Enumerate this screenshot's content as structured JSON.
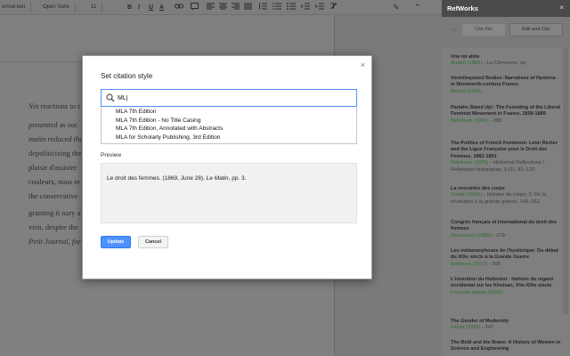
{
  "toolbar": {
    "style_label": "ormal text",
    "font_label": "Open Sans",
    "size_label": "11",
    "bold": "B",
    "italic": "I",
    "underline": "U",
    "text_color": "A",
    "pen_icon": "✎",
    "collapse_icon": "⌃"
  },
  "document": {
    "lines": [
      {
        "text": "Yet reactions to t"
      },
      {
        "text": "presented as suc"
      },
      {
        "text": "matin reduced the"
      },
      {
        "text": "depoliticizing the"
      },
      {
        "text": "plaisir d'assister"
      },
      {
        "text": "couleurs, nous re"
      },
      {
        "text": "the conservative"
      },
      {
        "text": "granting it nary a"
      },
      {
        "text": "vein, despite the"
      },
      {
        "text": "Petit Journal, for i"
      }
    ]
  },
  "dialog": {
    "title": "Set citation style",
    "close": "×",
    "search_value": "ML|",
    "suggestions": [
      "MLA 7th Edition",
      "MLA 7th Edition - No Title Casing",
      "MLA 7th Edition, Annotated with Abstracts",
      "MLA for Scholarly Publishing, 3rd Edition"
    ],
    "preview_label": "Preview",
    "preview_text_before": "Le droit des femmes. (1869, June 28). ",
    "preview_text_italic": "Le Matin",
    "preview_text_after": ", pp. 3.",
    "update_label": "Update",
    "cancel_label": "Cancel"
  },
  "refworks": {
    "title": "RefWorks",
    "close": "×",
    "tab_le": "Le",
    "cite_label": "Cite this",
    "edit_label": "Edit and Cite",
    "entries": [
      {
        "title": "Une loi atèle",
        "author": "Audert (1881)",
        "rest": " - La Citoyenne, np"
      },
      {
        "title": "Ventriloquized Bodies: Narratives of Hysteria in Nineteenth-century France",
        "author": "Beizer (1994)",
        "rest": ""
      },
      {
        "title": "Pariahs Stand Up!: The Founding of the Liberal Feminist Movement in France, 1858-1889",
        "author": "Bidelman (1982)",
        "rest": " - 285"
      },
      {
        "title": "The Politics of French Feminism: Léon Richer and the Ligue Française pour le Droit des Femmes, 1882-1891",
        "author": "Bidelman (1976)",
        "rest": " - Historical Reflections / Reflexions historiques, 3 (1), 93–120"
      },
      {
        "title": "La rencontre des corps",
        "author": "Corbin (2005)",
        "rest": " - Histoire du corps: 2: De la révolution à la grande guerre, 149–261"
      },
      {
        "title": "Congrès français et international du droit des femmes",
        "author": "Desraimes (1889)",
        "rest": " - 279"
      },
      {
        "title": "Les métamorphoses de l'hystérique: Du début du XIXe siècle à la Grande Guerre",
        "author": "Edelman (2013)",
        "rest": " - 395"
      },
      {
        "title": "L'invention du Hottentot : histoire du regard occidental sur les Khoisan, XVe-XIXe siècle",
        "author": "Fauvelle-Aymar (2002)",
        "rest": ""
      },
      {
        "title": "The Gender of Modernity",
        "author": "Felski (1995)",
        "rest": " - 247"
      },
      {
        "title": "The Bold and the Brave: A History of Women in Science and Engineering",
        "author": "",
        "rest": ""
      }
    ]
  },
  "colors": {
    "accent": "#4d90fe",
    "author_green": "#2b6e2b",
    "panel_header": "#4a4a4a",
    "overlay": "#7d7d7d"
  }
}
